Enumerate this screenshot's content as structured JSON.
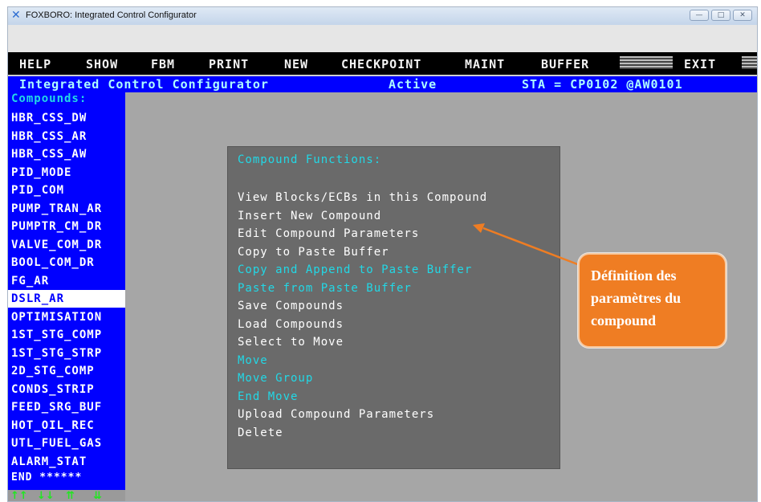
{
  "window": {
    "title": "FOXBORO: Integrated Control Configurator",
    "minimize": "—",
    "maximize": "□",
    "close": "✕"
  },
  "menubar": {
    "items": [
      "HELP",
      "SHOW",
      "FBM",
      "PRINT",
      "NEW",
      "CHECKPOINT",
      "MAINT",
      "BUFFER",
      "EXIT"
    ]
  },
  "status": {
    "title": "Integrated Control Configurator",
    "state": "Active",
    "station": "STA = CP0102 @AW0101"
  },
  "sidebar": {
    "heading": "Compounds:",
    "items": [
      "HBR_CSS_DW",
      "HBR_CSS_AR",
      "HBR_CSS_AW",
      "PID_MODE",
      "PID_COM",
      "PUMP_TRAN_AR",
      "PUMPTR_CM_DR",
      "VALVE_COM_DR",
      "BOOL_COM_DR",
      "FG_AR",
      "DSLR_AR",
      "OPTIMISATION",
      "1ST_STG_COMP",
      "1ST_STG_STRP",
      "2D_STG_COMP",
      "CONDS_STRIP",
      "FEED_SRG_BUF",
      "HOT_OIL_REC",
      "UTL_FUEL_GAS",
      "ALARM_STAT"
    ],
    "selected_index": 10,
    "end_text": "END ******",
    "scroll_arrows": [
      "↑↑",
      "↓↓",
      "⇈",
      "⇊"
    ]
  },
  "popup": {
    "title": "Compound Functions:",
    "items": [
      {
        "label": "View Blocks/ECBs in this Compound",
        "enabled": true
      },
      {
        "label": "Insert New Compound",
        "enabled": true
      },
      {
        "label": "Edit Compound Parameters",
        "enabled": true
      },
      {
        "label": "Copy to Paste Buffer",
        "enabled": true
      },
      {
        "label": "Copy and Append to Paste Buffer",
        "enabled": false
      },
      {
        "label": "Paste from Paste Buffer",
        "enabled": false
      },
      {
        "label": "Save Compounds",
        "enabled": true
      },
      {
        "label": "Load Compounds",
        "enabled": true
      },
      {
        "label": "Select to Move",
        "enabled": true
      },
      {
        "label": "Move",
        "enabled": false
      },
      {
        "label": "Move Group",
        "enabled": false
      },
      {
        "label": "End Move",
        "enabled": false
      },
      {
        "label": "Upload Compound Parameters",
        "enabled": true
      },
      {
        "label": "Delete",
        "enabled": true
      }
    ]
  },
  "callout": {
    "lines": [
      "Définition des",
      "paramètres du",
      "compound"
    ]
  },
  "colors": {
    "menubar_bg": "#000000",
    "status_bg": "#0000ff",
    "sidebar_bg": "#0000ff",
    "workarea_bg": "#a6a6a6",
    "popup_bg": "#6a6a6a",
    "enabled_text": "#ffffff",
    "disabled_text": "#22d8e6",
    "callout_bg": "#ef7d23"
  }
}
